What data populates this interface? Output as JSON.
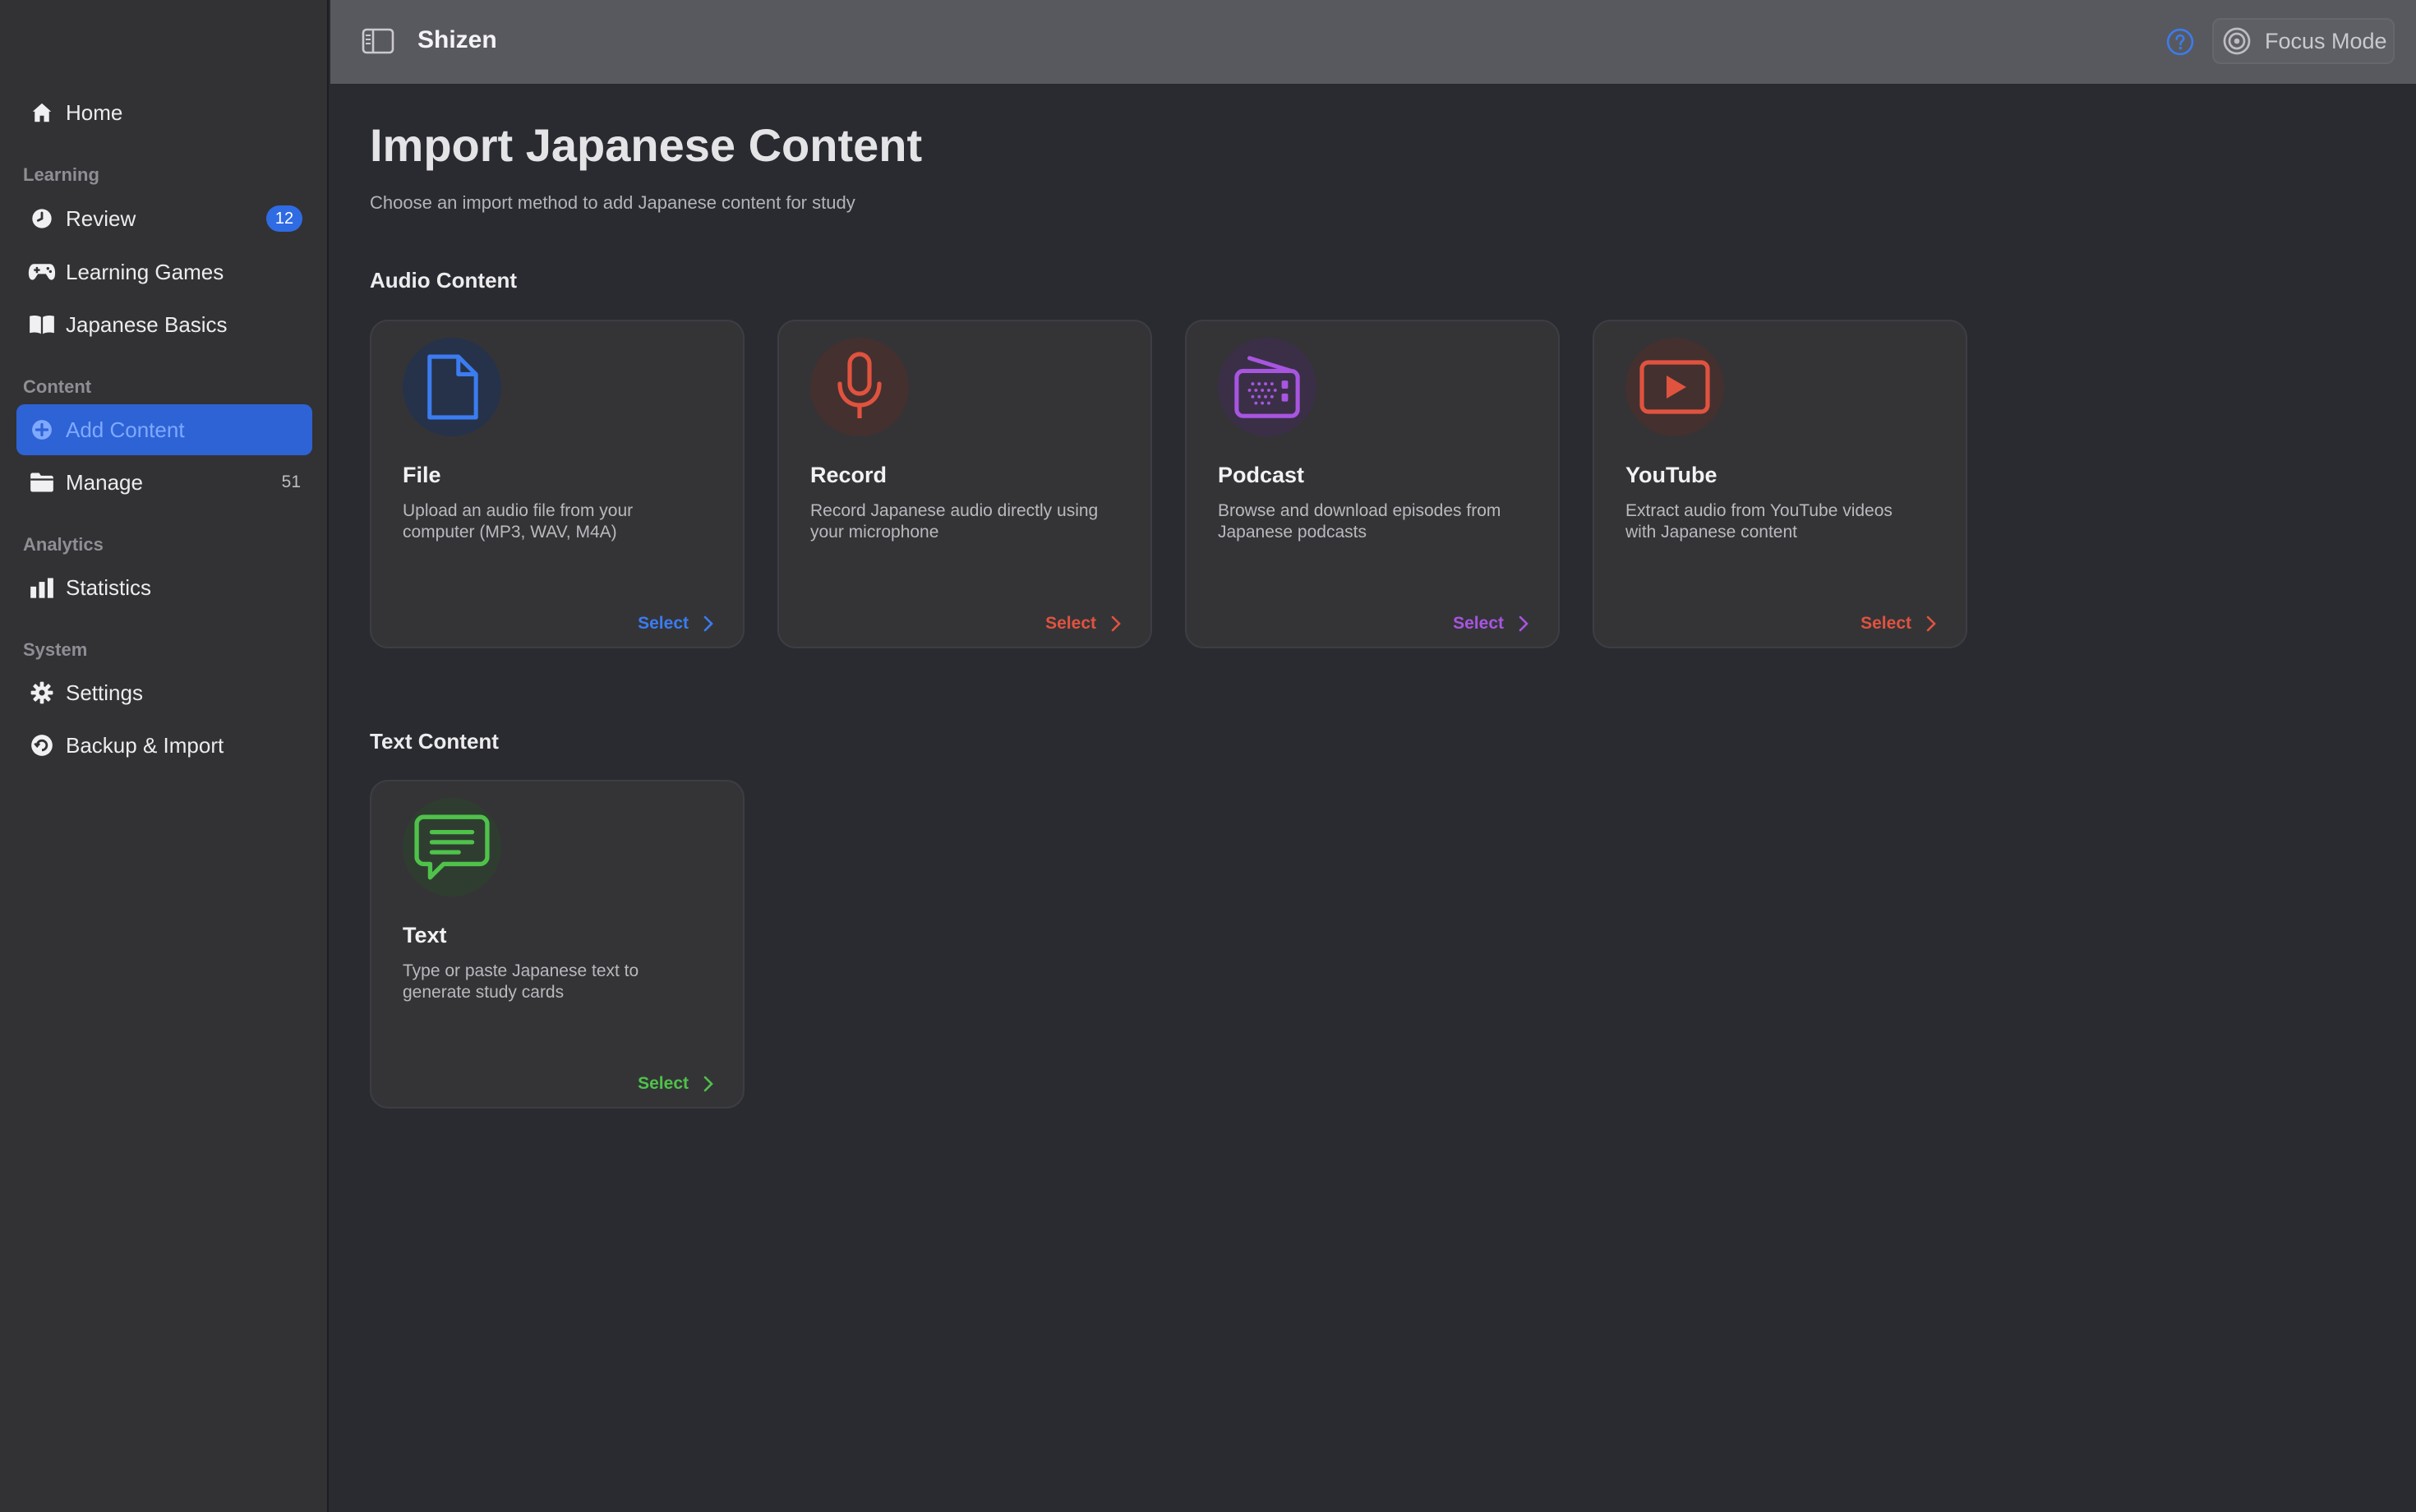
{
  "app": {
    "title": "Shizen"
  },
  "topbar": {
    "focus_mode_label": "Focus Mode"
  },
  "sidebar": {
    "home": {
      "label": "Home"
    },
    "sections": {
      "learning": "Learning",
      "content": "Content",
      "analytics": "Analytics",
      "system": "System"
    },
    "review": {
      "label": "Review",
      "badge": "12"
    },
    "learning_games": {
      "label": "Learning Games"
    },
    "japanese_basics": {
      "label": "Japanese Basics"
    },
    "add_content": {
      "label": "Add Content"
    },
    "manage": {
      "label": "Manage",
      "count": "51"
    },
    "statistics": {
      "label": "Statistics"
    },
    "settings": {
      "label": "Settings"
    },
    "backup_import": {
      "label": "Backup & Import"
    }
  },
  "main": {
    "title": "Import Japanese Content",
    "subtitle": "Choose an import method to add Japanese content for study",
    "audio_section": "Audio Content",
    "text_section": "Text Content",
    "cards": {
      "file": {
        "title": "File",
        "desc": "Upload an audio file from your computer (MP3, WAV, M4A)",
        "select": "Select",
        "color": "#3b7cf0"
      },
      "record": {
        "title": "Record",
        "desc": "Record Japanese audio directly using your microphone",
        "select": "Select",
        "color": "#e0533f"
      },
      "podcast": {
        "title": "Podcast",
        "desc": "Browse and download episodes from Japanese podcasts",
        "select": "Select",
        "color": "#a855e0"
      },
      "youtube": {
        "title": "YouTube",
        "desc": "Extract audio from YouTube videos with Japanese content",
        "select": "Select",
        "color": "#e0533f"
      },
      "text": {
        "title": "Text",
        "desc": "Type or paste Japanese text to generate study cards",
        "select": "Select",
        "color": "#4fc24a"
      }
    }
  }
}
